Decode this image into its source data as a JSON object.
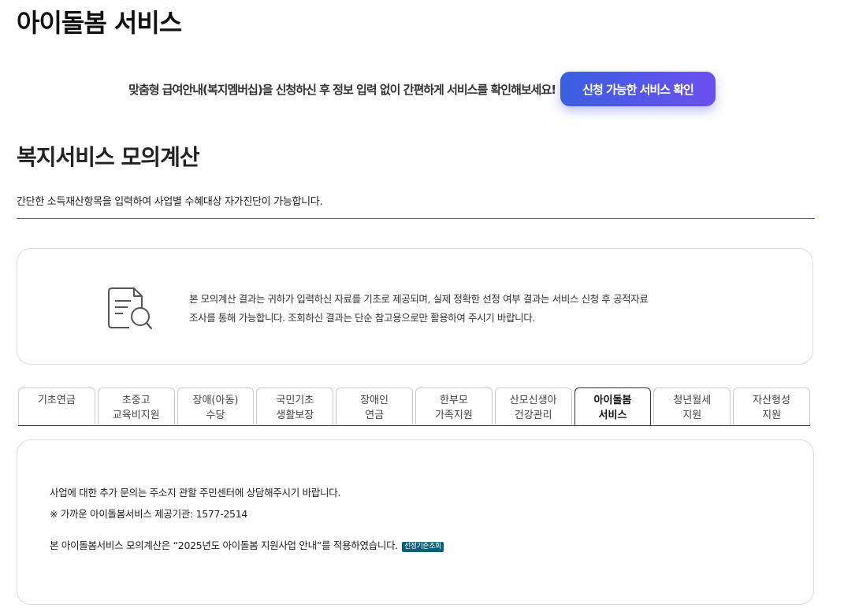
{
  "page": {
    "title": "아이돌봄 서비스"
  },
  "membership": {
    "text": "맞춤형 급여안내(복지멤버십)을 신청하신 후 정보 입력 없이 간편하게 서비스를 확인해보세요!",
    "button_label": "신청 가능한 서비스 확인"
  },
  "section": {
    "title": "복지서비스 모의계산",
    "description": "간단한 소득재산항목을 입력하여 사업별 수혜대상 자가진단이 가능합니다."
  },
  "notice": {
    "icon": "document-search-icon",
    "line1": "본 모의계산 결과는 귀하가 입력하신 자료를 기초로 제공되며, 실제 정확한 선정 여부 결과는 서비스 신청 후 공적자료",
    "line2": "조사를 통해 가능합니다. 조회하신 결과는 단순 참고용으로만 활용하여 주시기 바랍니다."
  },
  "tabs": [
    {
      "line1": "기초연금",
      "line2": ""
    },
    {
      "line1": "초중고",
      "line2": "교육비지원"
    },
    {
      "line1": "장애(아동)",
      "line2": "수당"
    },
    {
      "line1": "국민기초",
      "line2": "생활보장"
    },
    {
      "line1": "장애인",
      "line2": "연금"
    },
    {
      "line1": "한부모",
      "line2": "가족지원"
    },
    {
      "line1": "산모신생아",
      "line2": "건강관리"
    },
    {
      "line1": "아이돌봄",
      "line2": "서비스"
    },
    {
      "line1": "청년월세",
      "line2": "지원"
    },
    {
      "line1": "자산형성",
      "line2": "지원"
    }
  ],
  "content": {
    "inquiry": "사업에 대한 추가 문의는 주소지 관할 주민센터에 상담해주시기 바랍니다.",
    "provider": "※ 가까운 아이돌봄서비스 제공기관: 1577-2514",
    "basis": "본 아이돌봄서비스 모의계산은 “2025년도 아이돌봄 지원사업 안내”를 적용하였습니다.",
    "badge_label": "선정기준조회"
  },
  "colors": {
    "accent_start": "#3b5fe0",
    "accent_end": "#6c4ff0",
    "divider": "#1f6fb5",
    "badge": "#0b5e78"
  }
}
